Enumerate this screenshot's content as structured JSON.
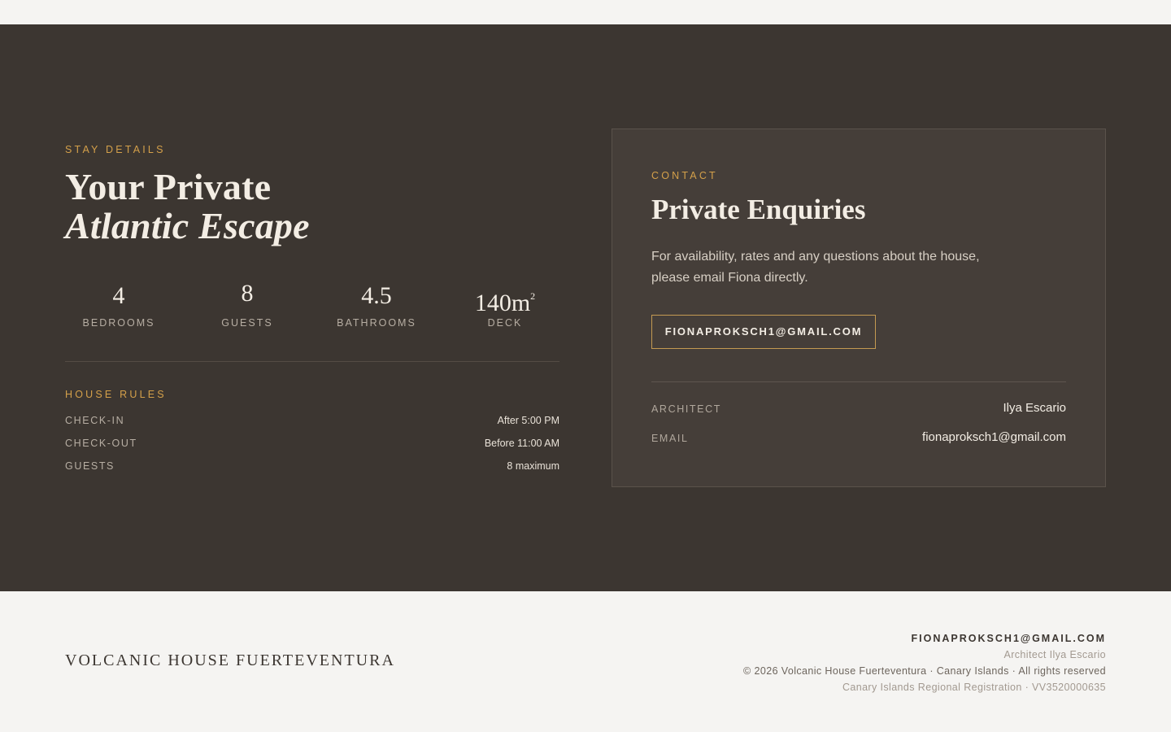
{
  "stay": {
    "kicker": "STAY DETAILS",
    "headline_line1": "Your Private",
    "headline_line2": "Atlantic Escape",
    "stats": [
      {
        "value": "4",
        "label": "BEDROOMS"
      },
      {
        "value": "8",
        "label": "GUESTS"
      },
      {
        "value": "4.5",
        "label": "BATHROOMS"
      },
      {
        "value": "140m",
        "sup": "2",
        "label": "DECK"
      }
    ]
  },
  "house_rules": {
    "kicker": "HOUSE RULES",
    "rows": [
      {
        "key": "CHECK-IN",
        "value": "After 5:00 PM"
      },
      {
        "key": "CHECK-OUT",
        "value": "Before 11:00 AM"
      },
      {
        "key": "GUESTS",
        "value": "8 maximum"
      }
    ]
  },
  "contact": {
    "kicker": "CONTACT",
    "title": "Private Enquiries",
    "description": "For availability, rates and any questions about the house, please email Fiona directly.",
    "button_label": "FIONAPROKSCH1@GMAIL.COM",
    "rows": [
      {
        "key": "ARCHITECT",
        "value": "Ilya Escario"
      },
      {
        "key": "EMAIL",
        "value": "fionaproksch1@gmail.com"
      }
    ]
  },
  "footer": {
    "brand": "VOLCANIC HOUSE FUERTEVENTURA",
    "email": "FIONAPROKSCH1@GMAIL.COM",
    "architect": "Architect Ilya Escario",
    "copyright": "© 2026 Volcanic House Fuerteventura · Canary Islands · All rights reserved",
    "registration": "Canary Islands Regional Registration · VV3520000635"
  },
  "colors": {
    "dark_bg": "#3c3631",
    "card_bg": "#453e39",
    "accent": "#d4a04a",
    "light_bg": "#f5f4f2"
  }
}
